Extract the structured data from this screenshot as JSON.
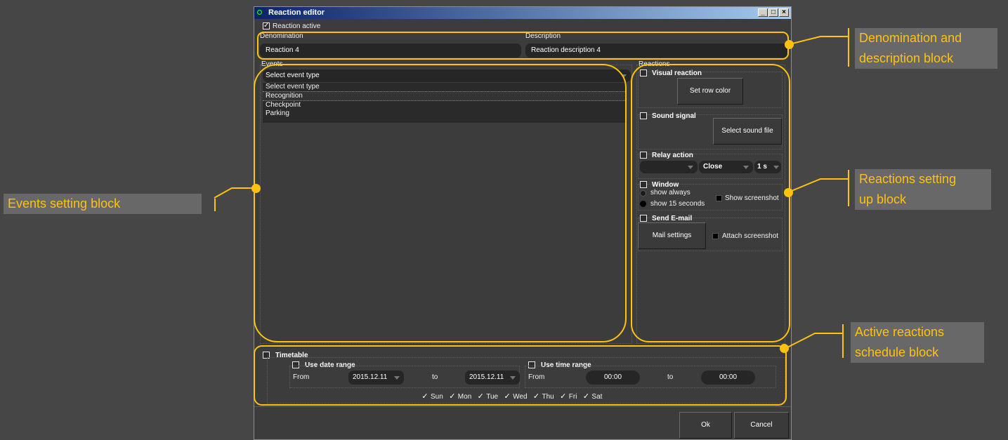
{
  "window": {
    "title": "Reaction editor"
  },
  "reaction_active": {
    "label": "Reaction active",
    "checked": "✓"
  },
  "denomination": {
    "label": "Denomination",
    "value": "Reaction 4"
  },
  "description": {
    "label": "Description",
    "value": "Reaction description 4"
  },
  "events": {
    "label": "Events",
    "selected": "Select event type",
    "options": [
      "Select event type",
      "Recognition",
      "Checkpoint",
      "Parking"
    ]
  },
  "reactions": {
    "label": "Reactions",
    "visual": {
      "label": "Visual reaction",
      "button": "Set row color"
    },
    "sound": {
      "label": "Sound signal",
      "button": "Select sound file"
    },
    "relay": {
      "label": "Relay action",
      "action": "Close",
      "duration": "1 s"
    },
    "window": {
      "label": "Window",
      "opt1": "show always",
      "opt2": "show 15 seconds",
      "screenshot": "Show screenshot"
    },
    "email": {
      "label": "Send E-mail",
      "button": "Mail settings",
      "attach": "Attach screenshot"
    }
  },
  "timetable": {
    "label": "Timetable",
    "date_range": {
      "label": "Use date range",
      "from_label": "From",
      "from": "2015.12.11",
      "to_label": "to",
      "to": "2015.12.11"
    },
    "time_range": {
      "label": "Use time range",
      "from_label": "From",
      "from": "00:00",
      "to_label": "to",
      "to": "00:00"
    },
    "days": [
      {
        "label": "Sun",
        "checked": "✓"
      },
      {
        "label": "Mon",
        "checked": "✓"
      },
      {
        "label": "Tue",
        "checked": "✓"
      },
      {
        "label": "Wed",
        "checked": "✓"
      },
      {
        "label": "Thu",
        "checked": "✓"
      },
      {
        "label": "Fri",
        "checked": "✓"
      },
      {
        "label": "Sat",
        "checked": "✓"
      }
    ]
  },
  "buttons": {
    "ok": "Ok",
    "cancel": "Cancel"
  },
  "window_buttons": {
    "minimize": "_",
    "maximize": "□",
    "close": "×"
  },
  "annotations": {
    "denomination_1": "Denomination and",
    "denomination_2": "description block",
    "events": "Events setting block",
    "reactions_1": "Reactions setting",
    "reactions_2": "up block",
    "schedule_1": "Active reactions",
    "schedule_2": "schedule block"
  },
  "colors": {
    "accent": "#ffc20e",
    "annotation_bg": "#686868",
    "window_bg": "#3c3c3c",
    "field_bg": "#262626"
  }
}
